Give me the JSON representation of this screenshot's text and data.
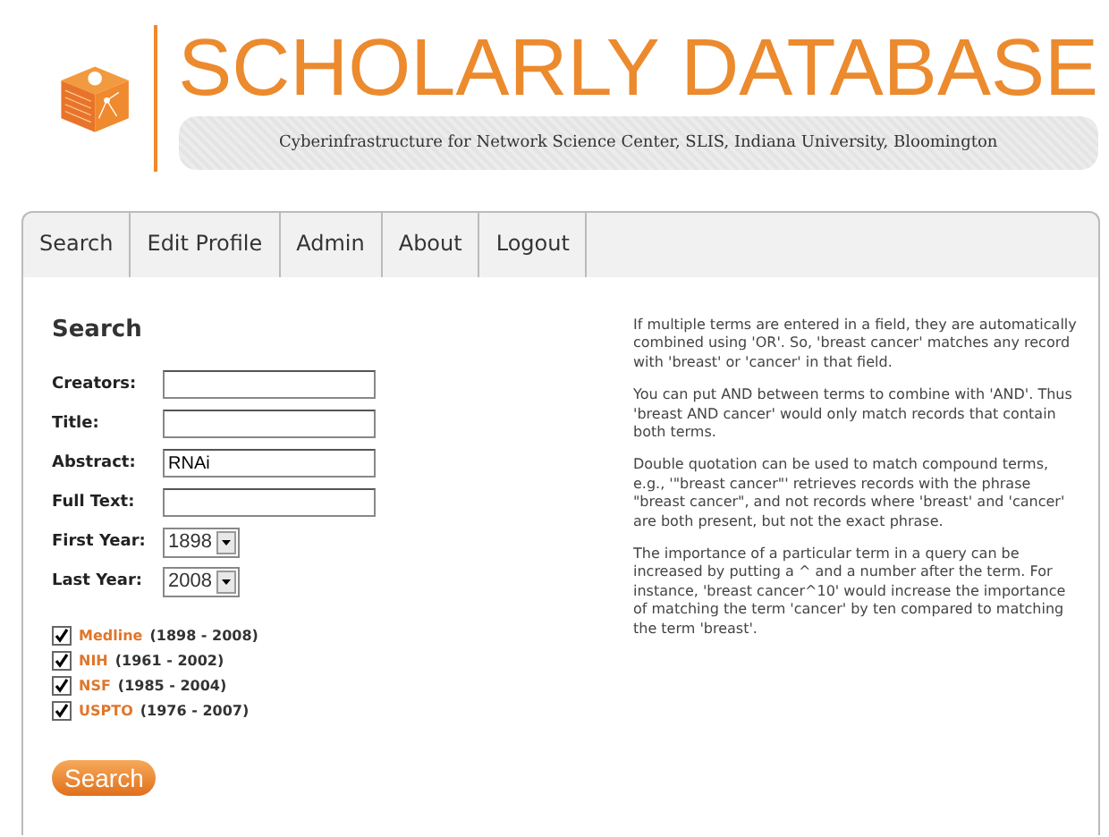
{
  "header": {
    "title": "SCHOLARLY DATABASE",
    "subtitle": "Cyberinfrastructure for Network Science Center, SLIS, Indiana University, Bloomington"
  },
  "tabs": [
    {
      "label": "Search"
    },
    {
      "label": "Edit Profile"
    },
    {
      "label": "Admin"
    },
    {
      "label": "About"
    },
    {
      "label": "Logout"
    }
  ],
  "search_form": {
    "heading": "Search",
    "fields": [
      {
        "kind": "text",
        "label": "Creators:"
      },
      {
        "kind": "text",
        "label": "Title:"
      },
      {
        "kind": "text",
        "label": "Abstract:",
        "value": "RNAi"
      },
      {
        "kind": "text",
        "label": "Full Text:"
      },
      {
        "kind": "select",
        "label": "First Year:",
        "value": "1898"
      },
      {
        "kind": "select",
        "label": "Last Year:",
        "value": "2008"
      }
    ],
    "sources": [
      {
        "name": "Medline",
        "range": "(1898 - 2008)",
        "checked": true
      },
      {
        "name": "NIH",
        "range": "(1961 - 2002)",
        "checked": true
      },
      {
        "name": "NSF",
        "range": "(1985 - 2004)",
        "checked": true
      },
      {
        "name": "USPTO",
        "range": "(1976 - 2007)",
        "checked": true
      }
    ],
    "button": "Search"
  },
  "help": [
    "If multiple terms are entered in a field, they are automatically combined using 'OR'. So, 'breast cancer' matches any record with 'breast' or 'cancer' in that field.",
    "You can put AND between terms to combine with 'AND'. Thus 'breast AND cancer' would only match records that contain both terms.",
    "Double quotation can be used to match compound terms, e.g., '\"breast cancer\"' retrieves records with the phrase \"breast cancer\", and not records where 'breast' and 'cancer' are both present, but not the exact phrase.",
    "The importance of a particular term in a query can be increased by putting a ^ and a number after the term. For instance, 'breast cancer^10' would increase the importance of matching the term 'cancer' by ten compared to matching the term 'breast'."
  ]
}
